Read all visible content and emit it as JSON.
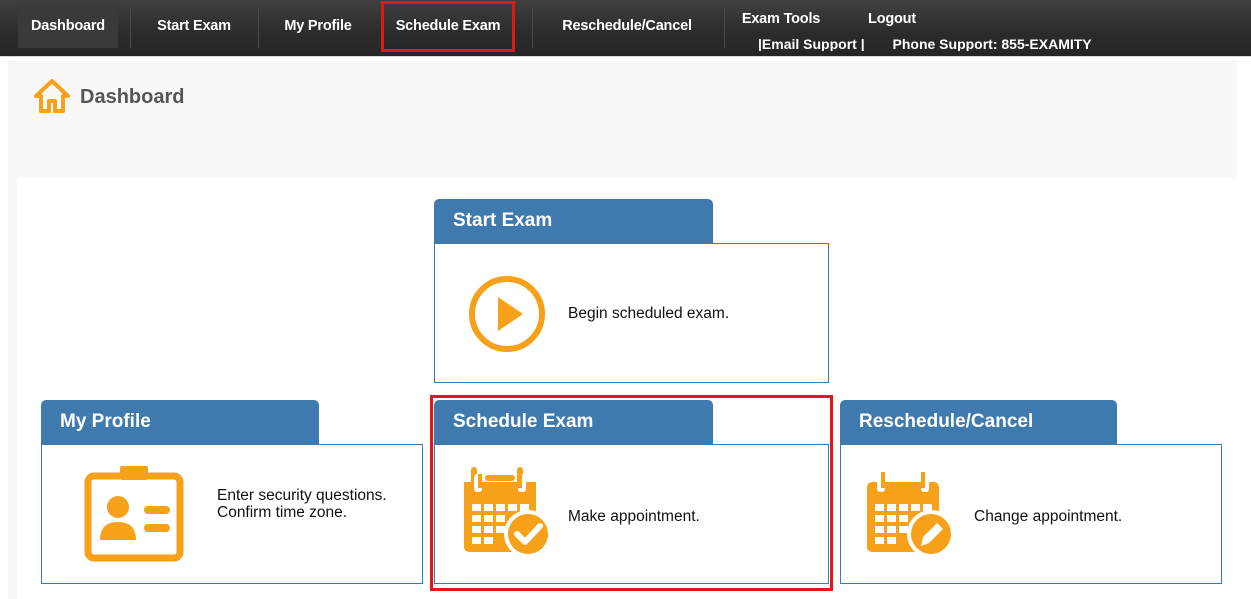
{
  "nav": {
    "items": [
      {
        "label": "Dashboard"
      },
      {
        "label": "Start Exam"
      },
      {
        "label": "My Profile"
      },
      {
        "label": "Schedule Exam"
      },
      {
        "label": "Reschedule/Cancel"
      },
      {
        "label": "Exam Tools"
      },
      {
        "label": "Logout"
      }
    ],
    "email_support": "|Email Support |",
    "phone_support": "Phone Support: 855-EXAMITY"
  },
  "header": {
    "title": "Dashboard"
  },
  "cards": {
    "start_exam": {
      "title": "Start Exam",
      "description": "Begin scheduled exam."
    },
    "my_profile": {
      "title": "My Profile",
      "description": "Enter security questions. Confirm time zone."
    },
    "schedule_exam": {
      "title": "Schedule Exam",
      "description": "Make appointment."
    },
    "reschedule": {
      "title": "Reschedule/Cancel",
      "description": "Change appointment."
    }
  },
  "colors": {
    "accent": "#3f7aaf",
    "icon": "#f7a11a",
    "highlight": "#e01818",
    "navbar": "#2b2b2b"
  }
}
